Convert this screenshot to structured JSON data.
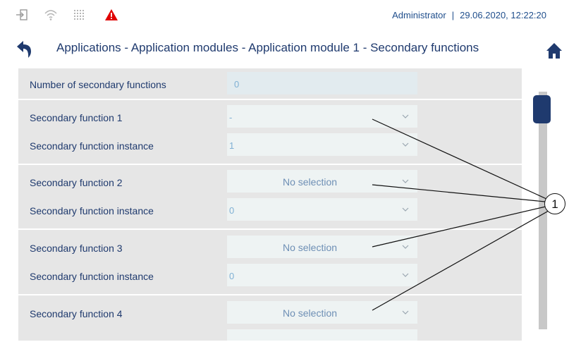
{
  "status": {
    "user": "Administrator",
    "separator": "|",
    "datetime": "29.06.2020, 12:22:20"
  },
  "icons": {
    "login": "login-icon",
    "wifi": "wifi-icon",
    "network": "network-grid-icon",
    "warning": "warning-icon",
    "back": "back-arrow-icon",
    "home": "home-icon",
    "chevron": "chevron-down-icon"
  },
  "colors": {
    "title_blue": "#1f3a6e",
    "warning_red": "#e00000",
    "content_bg": "#e6e6e6",
    "field_bg": "#eef3f3",
    "scroll_thumb": "#1f3a6e"
  },
  "header": {
    "title": "Applications - Application modules - Application module 1 - Secondary functions"
  },
  "form": {
    "count_label": "Number of secondary functions",
    "count_value": "0",
    "groups": [
      {
        "function_label": "Secondary function 1",
        "function_value": "-",
        "instance_label": "Secondary function instance",
        "instance_value": "1"
      },
      {
        "function_label": "Secondary function 2",
        "function_value": "No selection",
        "instance_label": "Secondary function instance",
        "instance_value": "0"
      },
      {
        "function_label": "Secondary function 3",
        "function_value": "No selection",
        "instance_label": "Secondary function instance",
        "instance_value": "0"
      },
      {
        "function_label": "Secondary function 4",
        "function_value": "No selection"
      }
    ]
  },
  "callout": {
    "number": "1"
  }
}
